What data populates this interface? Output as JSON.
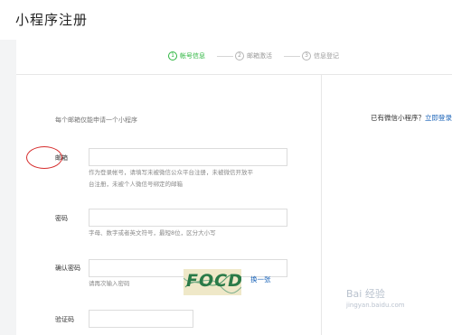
{
  "page": {
    "title": "小程序注册"
  },
  "steps": [
    {
      "num": "1",
      "label": "帐号信息"
    },
    {
      "num": "2",
      "label": "邮箱激活"
    },
    {
      "num": "3",
      "label": "信息登记"
    }
  ],
  "form": {
    "hint": "每个邮箱仅能申请一个小程序",
    "email": {
      "label": "邮箱",
      "help_line1": "作为登录帐号，请填写未被微信公众平台注册，未被微信开放平",
      "help_line2": "台注册，未被个人微信号绑定的邮箱"
    },
    "password": {
      "label": "密码",
      "help": "字母、数字或者英文符号，最短8位，区分大小写"
    },
    "confirm": {
      "label": "确认密码",
      "help": "请再次输入密码"
    },
    "captcha": {
      "label": "验证码",
      "image_text": "FOCD",
      "refresh": "换一张"
    }
  },
  "aside": {
    "question": "已有微信小程序？",
    "link": "立即登录"
  },
  "watermark": {
    "line1": "Bai 经验",
    "line2": "jingyan.baidu.com"
  },
  "colors": {
    "accent": "#2bb53e",
    "link": "#1a63b8",
    "highlight": "#d62c2c"
  }
}
